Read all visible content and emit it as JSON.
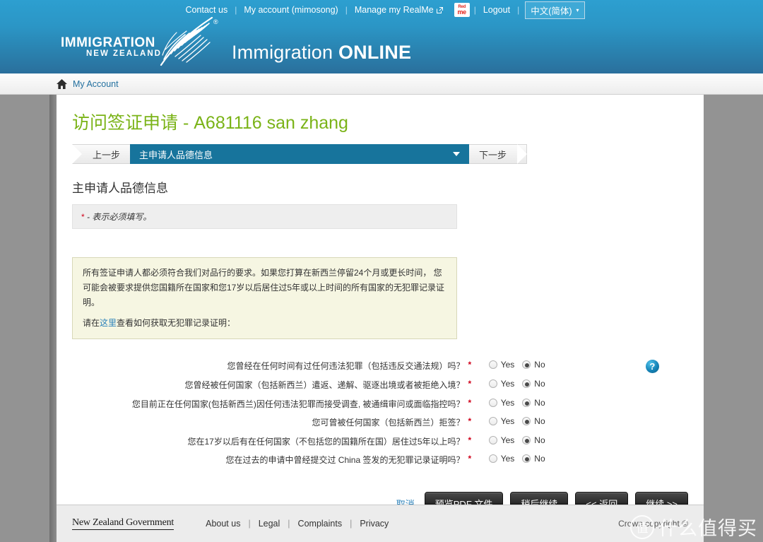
{
  "utility_nav": {
    "items": [
      {
        "label": "Contact us",
        "icon": null
      },
      {
        "label": "My account (mimosong)",
        "icon": null
      },
      {
        "label": "Manage my RealMe",
        "icon": "external-link-icon"
      },
      {
        "label": "Logout",
        "icon": null
      }
    ],
    "realme_badge": {
      "line1": "Red",
      "line2": "me"
    },
    "language": {
      "value": "中文(简体)",
      "caret": "▾"
    }
  },
  "brand": {
    "logo_line1": "IMMIGRATION",
    "logo_line2": "NEW ZEALAND",
    "registered_mark": "®",
    "product_title_thin": "Immigration ",
    "product_title_bold": "ONLINE"
  },
  "breadcrumb": {
    "home_icon": "home-icon",
    "label": "My Account"
  },
  "page": {
    "title_cn": "访问签证申请",
    "title_sep": " - ",
    "title_id": "A681116 san zhang"
  },
  "stepnav": {
    "prev_label": "上一步",
    "current_step": "主申请人品德信息",
    "next_label": "下一步"
  },
  "section": {
    "title": "主申请人品德信息",
    "required_star": "*",
    "required_note": "- 表示必须填写。"
  },
  "infobox": {
    "paragraph1": "所有签证申请人都必须符合我们对品行的要求。如果您打算在新西兰停留24个月或更长时间， 您可能会被要求提供您国籍所在国家和您17岁以后居住过5年或以上时间的所有国家的无犯罪记录证明。",
    "paragraph2_prefix": "请在",
    "paragraph2_link": "这里",
    "paragraph2_suffix": "查看如何获取无犯罪记录证明："
  },
  "questions": [
    {
      "label": "您曾经在任何时间有过任何违法犯罪（包括违反交通法规）吗？",
      "required": "*",
      "yes_label": "Yes",
      "no_label": "No",
      "selected": "No",
      "help": true
    },
    {
      "label": "您曾经被任何国家（包括新西兰）遣返、递解、驱逐出境或者被拒绝入境？",
      "required": "*",
      "yes_label": "Yes",
      "no_label": "No",
      "selected": "No",
      "help": false
    },
    {
      "label": "您目前正在任何国家(包括新西兰)因任何违法犯罪而接受调查, 被通缉审问或面临指控吗？",
      "required": "*",
      "yes_label": "Yes",
      "no_label": "No",
      "selected": "No",
      "help": false
    },
    {
      "label": "您可曾被任何国家（包括新西兰）拒签？",
      "required": "*",
      "yes_label": "Yes",
      "no_label": "No",
      "selected": "No",
      "help": false
    },
    {
      "label": "您在17岁以后有在任何国家（不包括您的国籍所在国）居住过5年以上吗？",
      "required": "*",
      "yes_label": "Yes",
      "no_label": "No",
      "selected": "No",
      "help": false
    },
    {
      "label": "您在过去的申请中曾经提交过 China 签发的无犯罪记录证明吗？",
      "required": "*",
      "yes_label": "Yes",
      "no_label": "No",
      "selected": "No",
      "help": false
    }
  ],
  "actions": {
    "cancel": "取消",
    "preview_pdf": "预览PDF 文件",
    "save_later": "稍后继续",
    "back": "<< 返回",
    "continue": "继续 >>"
  },
  "footer": {
    "govt_logo": "New Zealand Government",
    "links": [
      "About us",
      "Legal",
      "Complaints",
      "Privacy"
    ],
    "separator": "|",
    "crown": "Crown copyright ©"
  },
  "watermark": {
    "mark": "值",
    "text": "什么值得买"
  },
  "colors": {
    "header_blue_top": "#2d9fd0",
    "header_blue_bottom": "#2a6f9c",
    "title_green": "#7ab317",
    "step_active": "#17749c",
    "link_blue": "#2980b9",
    "required_red": "#d0021b",
    "info_bg": "#f6f6e2",
    "page_gray": "#939393"
  }
}
